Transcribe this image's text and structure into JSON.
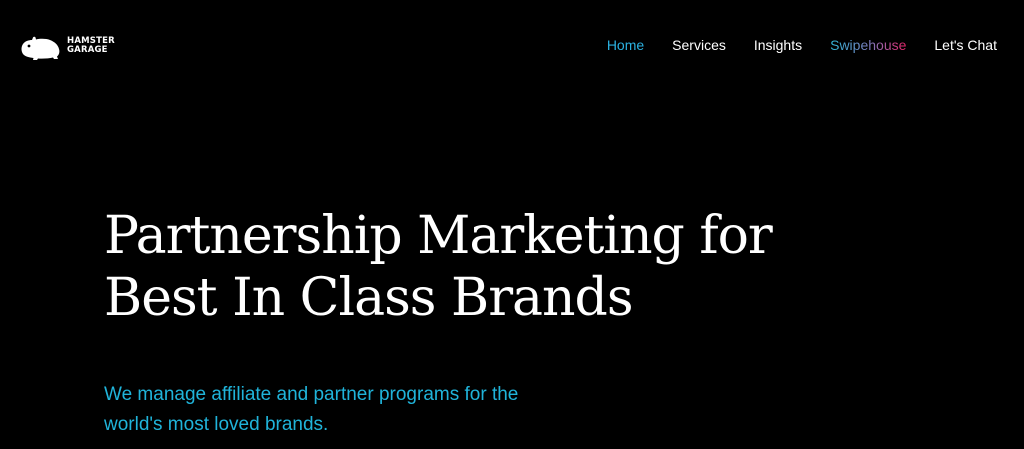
{
  "brand": {
    "line1": "HAMSTER",
    "line2": "GARAGE",
    "icon": "hamster-icon"
  },
  "nav": {
    "items": [
      {
        "label": "Home",
        "state": "active",
        "color": "#2bb1e0"
      },
      {
        "label": "Services",
        "state": "default",
        "color": "#ffffff"
      },
      {
        "label": "Insights",
        "state": "default",
        "color": "#ffffff"
      },
      {
        "label": "Swipehouse",
        "state": "gradient",
        "gradient": [
          "#2fb6d6",
          "#7a7ec0",
          "#e3256a"
        ]
      },
      {
        "label": "Let's Chat",
        "state": "default",
        "color": "#ffffff"
      }
    ]
  },
  "hero": {
    "title_line1": "Partnership Marketing for",
    "title_line2": "Best In Class Brands",
    "subtitle_line1": "We manage affiliate and partner programs for the",
    "subtitle_line2": "world's most loved brands.",
    "subtitle_color": "#20b4da"
  },
  "colors": {
    "background": "#000000",
    "text": "#ffffff",
    "accent": "#2bb1e0"
  }
}
